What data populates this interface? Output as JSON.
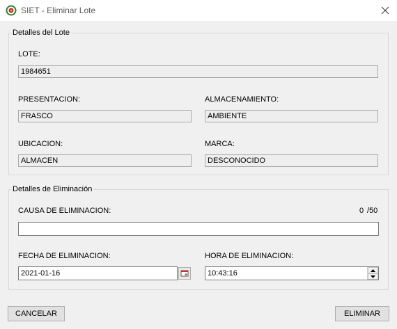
{
  "window": {
    "title": "SIET - Eliminar Lote",
    "icon": "siet-app-icon"
  },
  "lote_group": {
    "title": "Detalles del Lote",
    "lote_label": "LOTE:",
    "lote_value": "1984651",
    "presentacion_label": "PRESENTACION:",
    "presentacion_value": "FRASCO",
    "almacenamiento_label": "ALMACENAMIENTO:",
    "almacenamiento_value": "AMBIENTE",
    "ubicacion_label": "UBICACION:",
    "ubicacion_value": "ALMACEN",
    "marca_label": "MARCA:",
    "marca_value": "DESCONOCIDO"
  },
  "eliminacion_group": {
    "title": "Detalles de Eliminación",
    "causa_label": "CAUSA DE ELIMINACION:",
    "causa_value": "",
    "char_count": "0",
    "char_max": "/50",
    "fecha_label": "FECHA DE ELIMINACION:",
    "fecha_value": "2021-01-16",
    "hora_label": "HORA DE ELIMINACION:",
    "hora_value": "10:43:16"
  },
  "buttons": {
    "cancel": "CANCELAR",
    "delete": "ELIMINAR"
  }
}
